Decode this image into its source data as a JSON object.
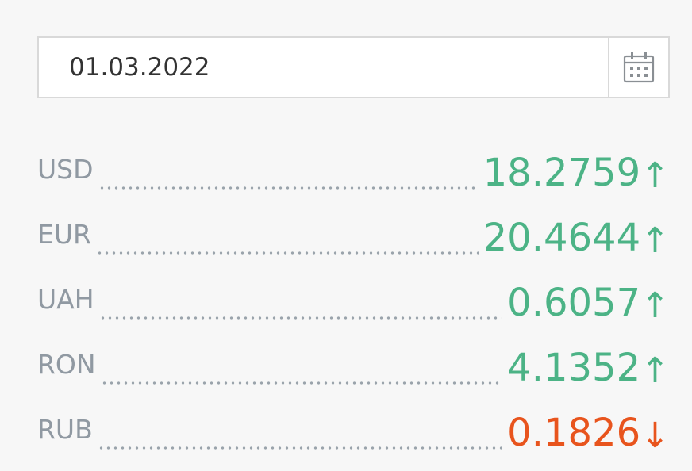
{
  "date_picker": {
    "value": "01.03.2022",
    "icon": "calendar-icon"
  },
  "colors": {
    "up": "#4cb386",
    "down": "#e8541d"
  },
  "rates": [
    {
      "code": "USD",
      "value": "18.2759",
      "direction": "up",
      "arrow": "↑"
    },
    {
      "code": "EUR",
      "value": "20.4644",
      "direction": "up",
      "arrow": "↑"
    },
    {
      "code": "UAH",
      "value": "0.6057",
      "direction": "up",
      "arrow": "↑"
    },
    {
      "code": "RON",
      "value": "4.1352",
      "direction": "up",
      "arrow": "↑"
    },
    {
      "code": "RUB",
      "value": "0.1826",
      "direction": "down",
      "arrow": "↓"
    }
  ]
}
